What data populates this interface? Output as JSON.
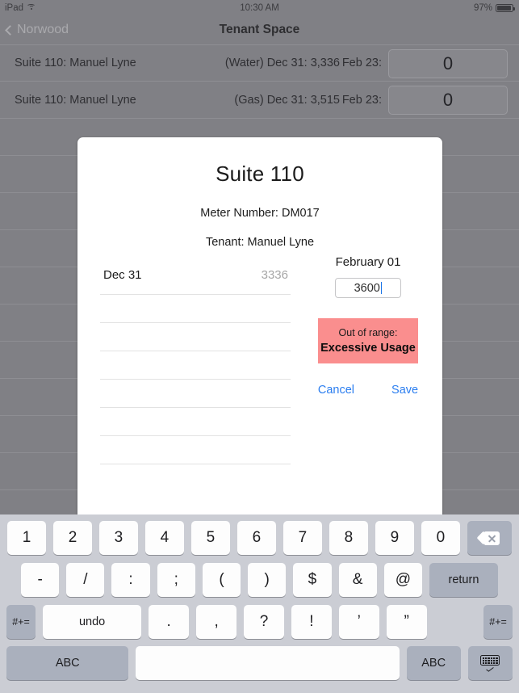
{
  "status_bar": {
    "device": "iPad",
    "wifi_icon": "wifi-icon",
    "time": "10:30 AM",
    "battery_pct": "97%",
    "battery_icon": "battery-icon"
  },
  "nav": {
    "back_label": "Norwood",
    "back_icon": "chevron-left-icon",
    "title": "Tenant Space"
  },
  "list": {
    "rows": [
      {
        "name": "Suite 110: Manuel Lyne",
        "reading": "(Water) Dec 31: 3,336",
        "date": "Feb 23:",
        "value": "0"
      },
      {
        "name": "Suite 110: Manuel Lyne",
        "reading": "(Gas) Dec 31: 3,515",
        "date": "Feb 23:",
        "value": "0"
      }
    ],
    "empty_row_count": 11
  },
  "modal": {
    "title": "Suite 110",
    "meter_number": "Meter Number: DM017",
    "tenant": "Tenant: Manuel Lyne",
    "readings": [
      {
        "label": "Dec 31",
        "value": "3336"
      },
      {
        "label": "",
        "value": ""
      },
      {
        "label": "",
        "value": ""
      },
      {
        "label": "",
        "value": ""
      },
      {
        "label": "",
        "value": ""
      },
      {
        "label": "",
        "value": ""
      },
      {
        "label": "",
        "value": ""
      }
    ],
    "entry": {
      "date_label": "February 01",
      "input_value": "3600",
      "input_placeholder": ""
    },
    "error": {
      "line1": "Out of range:",
      "line2": "Excessive Usage",
      "bg_color": "#fa8e8e"
    },
    "cancel_label": "Cancel",
    "save_label": "Save",
    "accent_color": "#2b7ef0"
  },
  "keyboard": {
    "row1": [
      "1",
      "2",
      "3",
      "4",
      "5",
      "6",
      "7",
      "8",
      "9",
      "0"
    ],
    "backspace_icon": "backspace-icon",
    "row2": [
      "-",
      "/",
      ":",
      ";",
      "(",
      ")",
      "$",
      "&",
      "@"
    ],
    "return_label": "return",
    "row3_sym_left": "#+=",
    "undo_label": "undo",
    "row3": [
      ".",
      ",",
      "?",
      "!",
      "’",
      "”"
    ],
    "row3_sym_right": "#+=",
    "abc_left": "ABC",
    "space_label": "",
    "abc_right": "ABC",
    "hide_keyboard_icon": "hide-keyboard-icon"
  }
}
